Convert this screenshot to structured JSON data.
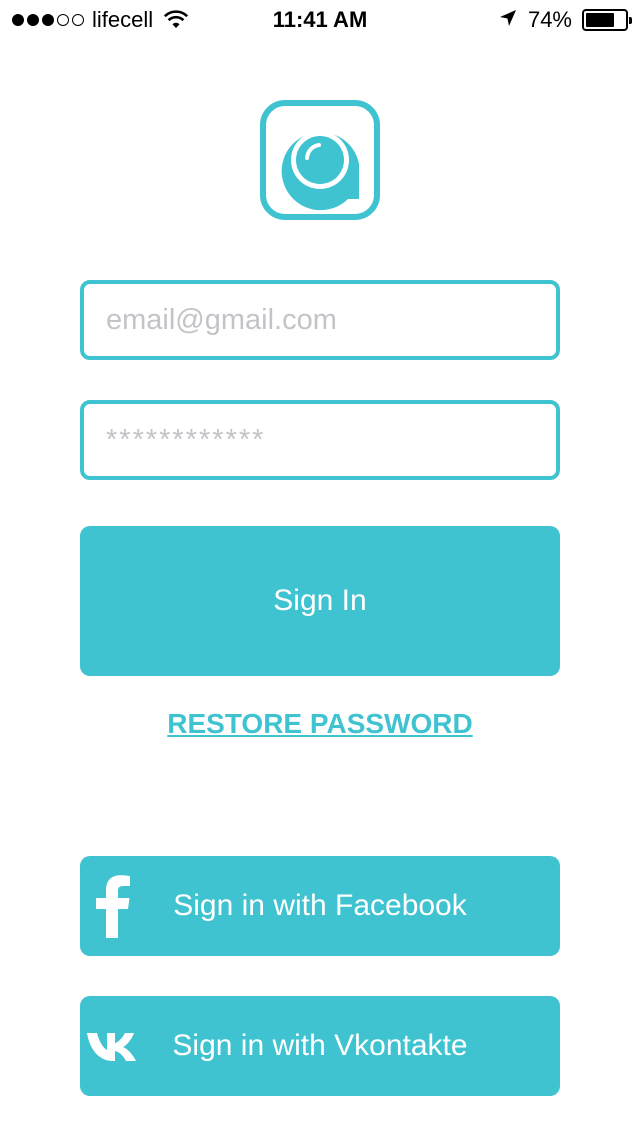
{
  "status_bar": {
    "carrier": "lifecell",
    "time": "11:41 AM",
    "battery_percent": "74%",
    "battery_level": 0.74,
    "signal_bars_filled": 3,
    "signal_bars_total": 5
  },
  "login": {
    "email_placeholder": "email@gmail.com",
    "password_placeholder": "************",
    "sign_in_label": "Sign In",
    "restore_password_label": "RESTORE PASSWORD",
    "facebook_label": "Sign in with Facebook",
    "vkontakte_label": "Sign in with Vkontakte"
  },
  "colors": {
    "accent": "#3fc3d1",
    "background": "#ffffff"
  },
  "icons": [
    "app-logo-icon",
    "facebook-icon",
    "vk-icon",
    "wifi-icon",
    "location-arrow-icon",
    "battery-icon"
  ]
}
